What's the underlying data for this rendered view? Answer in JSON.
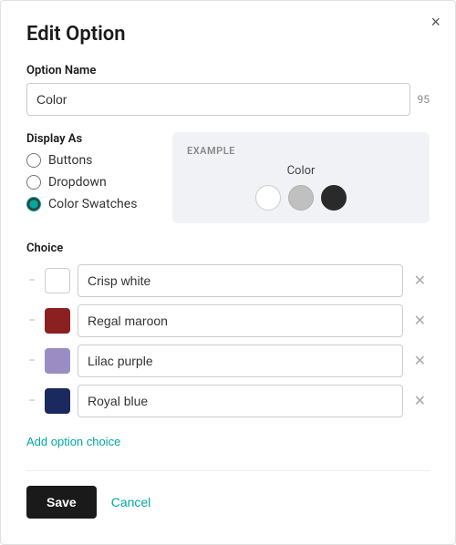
{
  "dialog": {
    "title": "Edit Option",
    "close_label": "×"
  },
  "option_name": {
    "label": "Option Name",
    "value": "Color",
    "char_count": "95"
  },
  "display_as": {
    "label": "Display As",
    "options": [
      {
        "id": "buttons",
        "label": "Buttons",
        "checked": false
      },
      {
        "id": "dropdown",
        "label": "Dropdown",
        "checked": false
      },
      {
        "id": "color_swatches",
        "label": "Color Swatches",
        "checked": true
      }
    ]
  },
  "example": {
    "section_label": "EXAMPLE",
    "preview_title": "Color",
    "swatches": [
      {
        "color": "#ffffff",
        "border": "#ccc"
      },
      {
        "color": "#c0c0c0",
        "border": "#b0b0b0"
      },
      {
        "color": "#2a2a2a",
        "border": "#2a2a2a"
      }
    ]
  },
  "choices": {
    "label": "Choice",
    "items": [
      {
        "name": "Crisp white",
        "color": "#ffffff",
        "color_border": "#ccc"
      },
      {
        "name": "Regal maroon",
        "color": "#8B2020",
        "color_border": "#8B2020"
      },
      {
        "name": "Lilac purple",
        "color": "#9b8dc4",
        "color_border": "#9b8dc4"
      },
      {
        "name": "Royal blue",
        "color": "#1a2a5e",
        "color_border": "#1a2a5e"
      }
    ],
    "add_label": "Add option choice"
  },
  "footer": {
    "save_label": "Save",
    "cancel_label": "Cancel"
  }
}
